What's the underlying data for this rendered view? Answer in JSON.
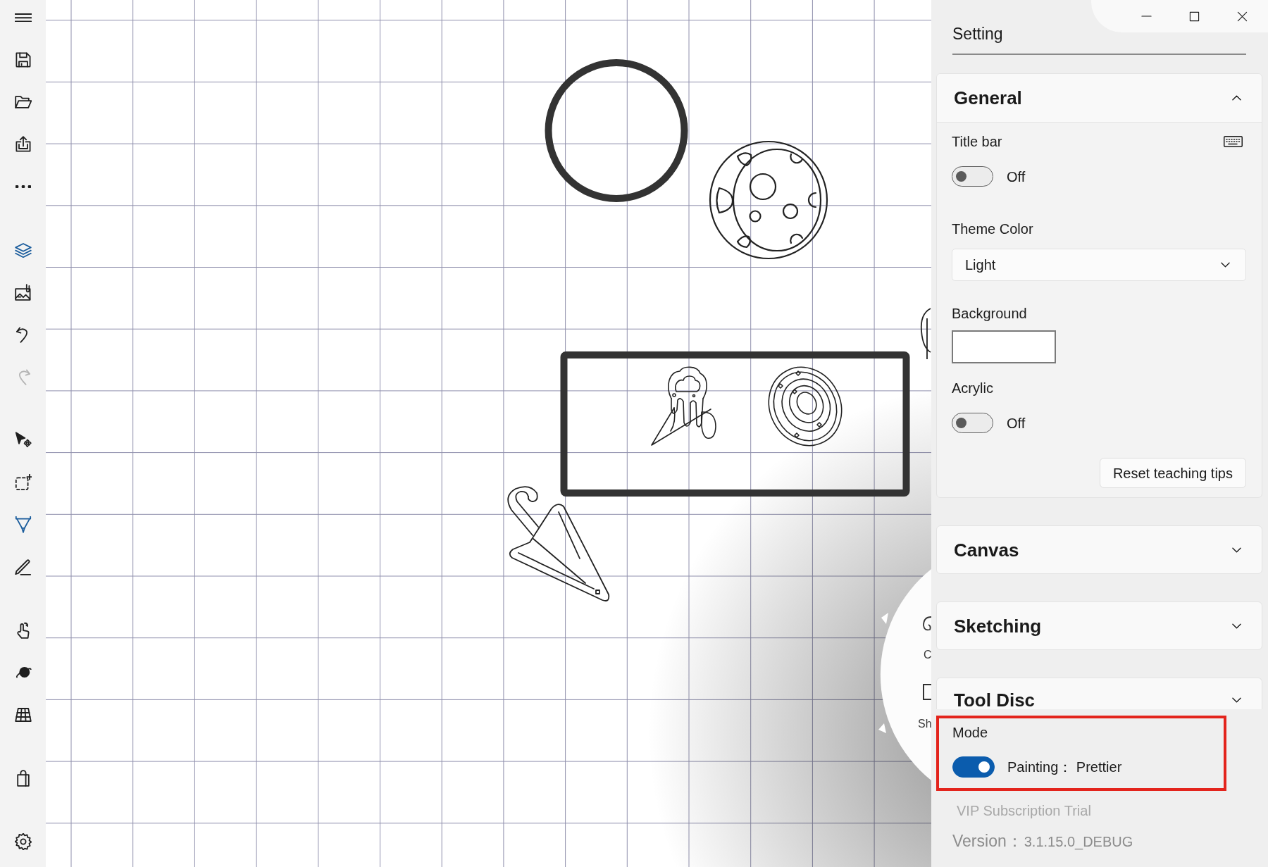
{
  "toolbar": {
    "groups": [
      [
        {
          "selected": false,
          "disabled": false
        },
        {
          "selected": false,
          "disabled": false
        },
        {
          "selected": false,
          "disabled": false
        },
        {
          "selected": false,
          "disabled": false
        },
        {
          "selected": false,
          "disabled": false
        }
      ],
      [
        {
          "selected": true,
          "disabled": false
        },
        {
          "selected": false,
          "disabled": false
        },
        {
          "selected": false,
          "disabled": false
        },
        {
          "selected": false,
          "disabled": true
        }
      ],
      [
        {
          "selected": false,
          "disabled": false
        },
        {
          "selected": false,
          "disabled": false
        },
        {
          "selected": true,
          "disabled": false
        },
        {
          "selected": false,
          "disabled": false
        }
      ],
      [
        {
          "selected": false,
          "disabled": false
        },
        {
          "selected": false,
          "disabled": false
        },
        {
          "selected": false,
          "disabled": false
        }
      ],
      [
        {
          "selected": false,
          "disabled": false
        }
      ],
      [
        {
          "selected": false,
          "disabled": false
        }
      ]
    ]
  },
  "tool_disc": {
    "labels": [
      "C",
      "Sh"
    ]
  },
  "settings": {
    "title": "Setting",
    "sections": [
      {
        "title": "General",
        "expanded": true,
        "items": [
          {
            "kind": "toggle",
            "label": "Title bar",
            "keyboard_hint": true,
            "on": false,
            "state_text": "Off"
          },
          {
            "kind": "dropdown",
            "label": "Theme Color",
            "value": "Light"
          },
          {
            "kind": "swatch",
            "label": "Background",
            "color": "#ffffff"
          },
          {
            "kind": "toggle",
            "label": "Acrylic",
            "on": false,
            "state_text": "Off"
          },
          {
            "kind": "button",
            "label": "Reset teaching tips"
          }
        ]
      },
      {
        "title": "Canvas",
        "expanded": false
      },
      {
        "title": "Sketching",
        "expanded": false
      },
      {
        "title": "Tool Disc",
        "expanded": false
      }
    ],
    "highlighted_setting": {
      "label": "Mode",
      "on": true,
      "state_text": "Painting： Prettier"
    },
    "footer": {
      "subscription": "VIP Subscription Trial",
      "version_label": "Version：",
      "version": "3.1.15.0_DEBUG"
    }
  }
}
